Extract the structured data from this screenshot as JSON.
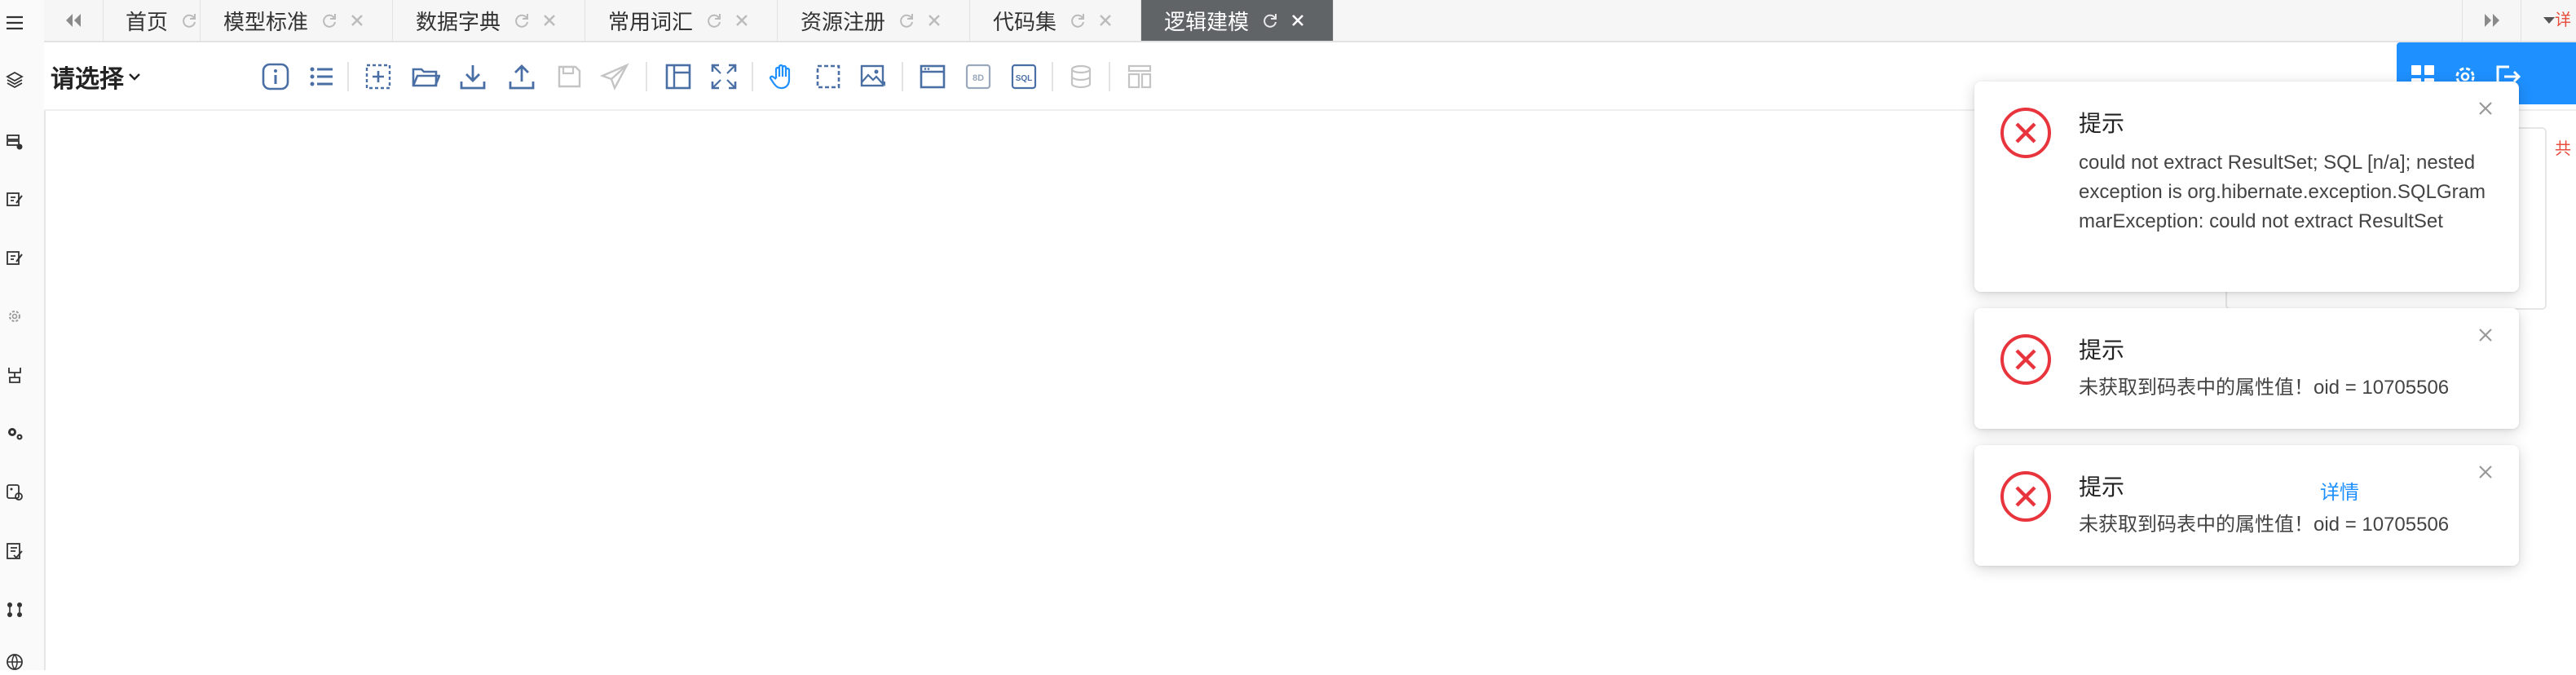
{
  "tabs": {
    "items": [
      {
        "label": "首页"
      },
      {
        "label": "模型标准"
      },
      {
        "label": "数据字典"
      },
      {
        "label": "常用词汇"
      },
      {
        "label": "资源注册"
      },
      {
        "label": "代码集"
      },
      {
        "label": "逻辑建模",
        "active": true
      }
    ]
  },
  "toolbar": {
    "select_label": "请选择",
    "icons": [
      "info-icon",
      "list-icon",
      "add-box-icon",
      "folder-open-icon",
      "download-icon",
      "upload-icon",
      "save-icon",
      "send-icon",
      "layout-icon",
      "fullscreen-icon",
      "hand-pan-icon",
      "marquee-select-icon",
      "image-export-icon",
      "window-icon",
      "ddl-icon",
      "sql-icon",
      "database-icon",
      "align-icon"
    ],
    "right_icons": [
      "grid-view-icon",
      "settings-icon",
      "logout-icon"
    ]
  },
  "sidebar": {
    "icons": [
      "menu-icon",
      "layers-icon",
      "server-settings-icon",
      "model-edit-icon",
      "model-edit-2-icon",
      "gear-icon",
      "tree-icon",
      "gears-icon",
      "image-settings-icon",
      "document-check-icon",
      "nodes-icon",
      "globe-icon"
    ]
  },
  "edge_text": [
    "共",
    "详"
  ],
  "notifications": [
    {
      "title": "提示",
      "message": "could not extract ResultSet; SQL [n/a]; nested exception is org.hibernate.exception.SQLGrammarException: could not extract ResultSet"
    },
    {
      "title": "提示",
      "message": "未获取到码表中的属性值！oid = 10705506"
    },
    {
      "title": "提示",
      "message": "未获取到码表中的属性值！oid = 10705506",
      "detail_label": "详情"
    }
  ],
  "colors": {
    "accent": "#1e90ff",
    "error": "#e8353d",
    "tab_active_bg": "#616467",
    "icon": "#4a6fa5"
  }
}
